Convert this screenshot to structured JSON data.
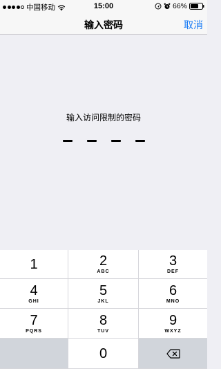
{
  "status_bar": {
    "carrier": "中国移动",
    "time": "15:00",
    "battery": "66%"
  },
  "nav": {
    "title": "输入密码",
    "cancel": "取消"
  },
  "prompt": "输入访问限制的密码",
  "pin": {
    "length": 4,
    "entered": 0
  },
  "keypad": {
    "keys": [
      {
        "num": "1",
        "letters": ""
      },
      {
        "num": "2",
        "letters": "ABC"
      },
      {
        "num": "3",
        "letters": "DEF"
      },
      {
        "num": "4",
        "letters": "GHI"
      },
      {
        "num": "5",
        "letters": "JKL"
      },
      {
        "num": "6",
        "letters": "MNO"
      },
      {
        "num": "7",
        "letters": "PQRS"
      },
      {
        "num": "8",
        "letters": "TUV"
      },
      {
        "num": "9",
        "letters": "WXYZ"
      },
      {
        "num": "0",
        "letters": ""
      }
    ]
  },
  "icons": {
    "wifi": "wifi-icon",
    "location": "location-icon",
    "alarm": "alarm-icon",
    "battery": "battery-icon",
    "delete": "backspace-icon"
  },
  "colors": {
    "accent": "#1a7cf6",
    "background": "#efeff4",
    "keypad_background": "#d1d5db"
  }
}
